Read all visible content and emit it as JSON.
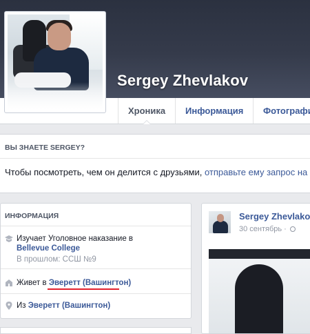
{
  "profile": {
    "name": "Sergey Zhevlakov"
  },
  "tabs": [
    {
      "label": "Хроника",
      "active": true
    },
    {
      "label": "Информация",
      "active": false
    },
    {
      "label": "Фотографи",
      "active": false
    }
  ],
  "know_box": {
    "title": "ВЫ ЗНАЕТЕ SERGEY?",
    "text": "Чтобы посмотреть, чем он делится с друзьями, ",
    "link": "отправьте ему запрос на до"
  },
  "info": {
    "title": "ИНФОРМАЦИЯ",
    "study": {
      "prefix": "Изучает Уголовное наказание в ",
      "link": "Bellevue College",
      "past": "В прошлом: ССШ №9"
    },
    "lives": {
      "prefix": "Живет в ",
      "link": "Эверетт (Вашингтон)"
    },
    "from": {
      "prefix": "Из ",
      "link": "Эверетт (Вашингтон)"
    }
  },
  "post": {
    "author": "Sergey Zhevlakov",
    "date": "30 сентябрь · "
  },
  "colors": {
    "link": "#3b5998",
    "cover": "#2b3140",
    "highlight_underline": "#e3202c"
  },
  "icons": {
    "study": "graduation-cap-icon",
    "lives": "house-icon",
    "from": "location-pin-icon",
    "privacy": "globe-icon"
  }
}
